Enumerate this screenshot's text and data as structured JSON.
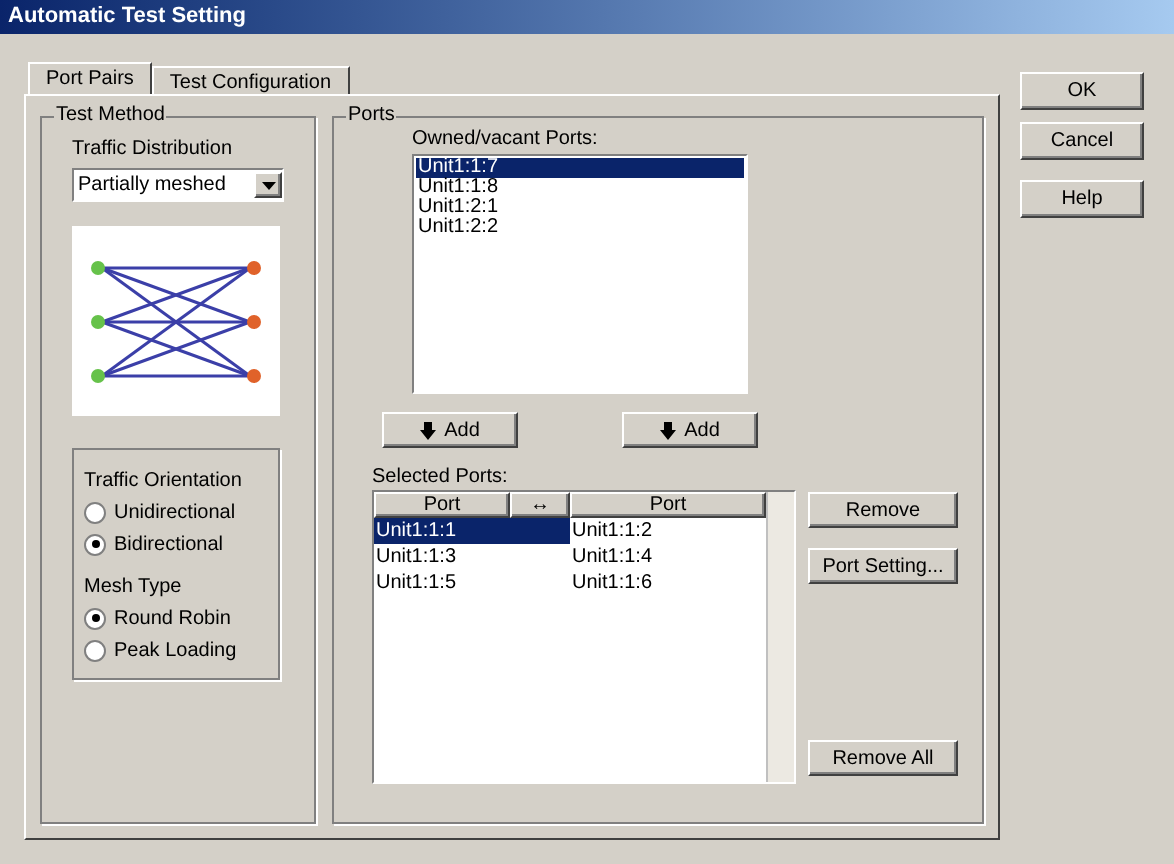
{
  "window": {
    "title": "Automatic Test Setting"
  },
  "tabs": [
    {
      "label": "Port Pairs",
      "selected": true
    },
    {
      "label": "Test Configuration",
      "selected": false
    }
  ],
  "test_method": {
    "title": "Test Method",
    "traffic_distribution": {
      "label": "Traffic Distribution",
      "value": "Partially meshed"
    },
    "traffic_orientation": {
      "title": "Traffic Orientation",
      "options": [
        {
          "label": "Unidirectional",
          "selected": false
        },
        {
          "label": "Bidirectional",
          "selected": true
        }
      ]
    },
    "mesh_type": {
      "title": "Mesh Type",
      "options": [
        {
          "label": "Round Robin",
          "selected": true
        },
        {
          "label": "Peak Loading",
          "selected": false
        }
      ]
    }
  },
  "ports": {
    "title": "Ports",
    "owned_label": "Owned/vacant Ports:",
    "owned": [
      {
        "label": "Unit1:1:7",
        "selected": true
      },
      {
        "label": "Unit1:1:8",
        "selected": false
      },
      {
        "label": "Unit1:2:1",
        "selected": false
      },
      {
        "label": "Unit1:2:2",
        "selected": false
      }
    ],
    "add_buttons": [
      "Add",
      "Add"
    ],
    "selected_label": "Selected Ports:",
    "columns": [
      "Port",
      "↔",
      "Port"
    ],
    "rows": [
      {
        "cells": [
          "Unit1:1:1",
          "Unit1:1:2"
        ],
        "selected": true
      },
      {
        "cells": [
          "Unit1:1:3",
          "Unit1:1:4"
        ],
        "selected": false
      },
      {
        "cells": [
          "Unit1:1:5",
          "Unit1:1:6"
        ],
        "selected": false
      }
    ],
    "side_buttons": [
      "Remove",
      "Port Setting...",
      "Remove All"
    ]
  },
  "buttons": [
    "OK",
    "Cancel",
    "Help"
  ]
}
